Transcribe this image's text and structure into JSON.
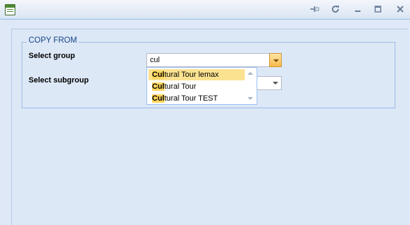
{
  "window": {
    "tools": [
      {
        "icon": "pin-icon",
        "glyph": "⊣"
      },
      {
        "icon": "refresh-icon",
        "glyph": "⟳"
      },
      {
        "icon": "minimize-icon",
        "glyph": "—"
      },
      {
        "icon": "maximize-icon",
        "glyph": "☐"
      },
      {
        "icon": "close-icon",
        "glyph": "✕"
      }
    ]
  },
  "form": {
    "legend": "COPY FROM",
    "group_label": "Select group",
    "group_value": "cul",
    "subgroup_label": "Select subgroup",
    "subgroup_value": ""
  },
  "dropdown": {
    "query": "Cul",
    "items": [
      {
        "match": "Cul",
        "rest": "tural Tour lemax",
        "selected": true
      },
      {
        "match": "Cul",
        "rest": "tural Tour",
        "selected": false
      },
      {
        "match": "Cul",
        "rest": "tural Tour TEST",
        "selected": false
      }
    ]
  }
}
